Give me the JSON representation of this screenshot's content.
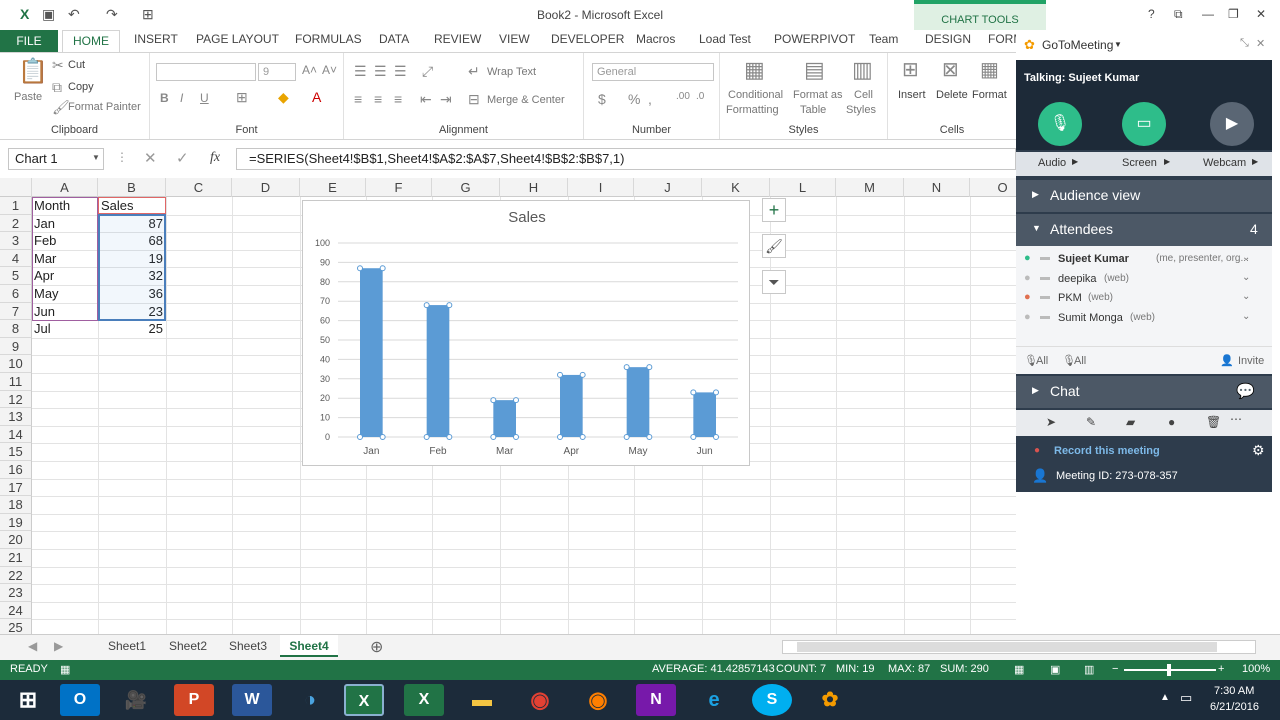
{
  "window": {
    "title": "Book2 - Microsoft Excel",
    "chart_tools": "CHART TOOLS"
  },
  "tabs": [
    "FILE",
    "HOME",
    "INSERT",
    "PAGE LAYOUT",
    "FORMULAS",
    "DATA",
    "REVIEW",
    "VIEW",
    "DEVELOPER",
    "Macros",
    "Load Test",
    "POWERPIVOT",
    "Team",
    "DESIGN",
    "FORMAT"
  ],
  "ribbon": {
    "paste": "Paste",
    "cut": "Cut",
    "copy": "Copy",
    "format_painter": "Format Painter",
    "clipboard": "Clipboard",
    "font_size": "9",
    "font_group": "Font",
    "wrap_text": "Wrap Text",
    "merge_center": "Merge & Center",
    "alignment": "Alignment",
    "number_format": "General",
    "number": "Number",
    "conditional": "Conditional",
    "formatting": "Formatting",
    "format_as": "Format as",
    "table": "Table",
    "cell": "Cell",
    "styles_btn": "Styles",
    "styles": "Styles",
    "insert": "Insert",
    "delete": "Delete",
    "format": "Format",
    "cells": "Cells"
  },
  "formula_bar": {
    "name_box": "Chart 1",
    "fx": "fx",
    "formula": "=SERIES(Sheet4!$B$1,Sheet4!$A$2:$A$7,Sheet4!$B$2:$B$7,1)"
  },
  "columns": [
    "A",
    "B",
    "C",
    "D",
    "E",
    "F",
    "G",
    "H",
    "I",
    "J",
    "K",
    "L",
    "M",
    "N",
    "O"
  ],
  "rows": [
    "1",
    "2",
    "3",
    "4",
    "5",
    "6",
    "7",
    "8",
    "9",
    "10",
    "11",
    "12",
    "13",
    "14",
    "15",
    "16",
    "17",
    "18",
    "19",
    "20",
    "21",
    "22",
    "23",
    "24",
    "25"
  ],
  "cells": {
    "a": [
      "Month",
      "Jan",
      "Feb",
      "Mar",
      "Apr",
      "May",
      "Jun",
      "Jul"
    ],
    "b": [
      "Sales",
      "87",
      "68",
      "19",
      "32",
      "36",
      "23",
      "25"
    ]
  },
  "chart_data": {
    "type": "bar",
    "title": "Sales",
    "categories": [
      "Jan",
      "Feb",
      "Mar",
      "Apr",
      "May",
      "Jun"
    ],
    "values": [
      87,
      68,
      19,
      32,
      36,
      23
    ],
    "ylim": [
      0,
      100
    ],
    "yticks": [
      "0",
      "10",
      "20",
      "30",
      "40",
      "50",
      "60",
      "70",
      "80",
      "90",
      "100"
    ],
    "color": "#5b9bd5",
    "grid": true
  },
  "sheets": [
    "Sheet1",
    "Sheet2",
    "Sheet3",
    "Sheet4"
  ],
  "active_sheet": "Sheet4",
  "status": {
    "ready": "READY",
    "average": "AVERAGE: 41.42857143",
    "count": "COUNT: 7",
    "min": "MIN: 19",
    "max": "MAX: 87",
    "sum": "SUM: 290",
    "zoom": "100%"
  },
  "gtm": {
    "app": "GoToMeeting",
    "talking": "Talking: Sujeet Kumar",
    "audio": "Audio",
    "screen": "Screen",
    "webcam": "Webcam",
    "audience_view": "Audience view",
    "attendees": "Attendees",
    "attendee_count": "4",
    "people": [
      {
        "name": "Sujeet Kumar",
        "meta": "(me, presenter, org..."
      },
      {
        "name": "deepika",
        "meta": "(web)"
      },
      {
        "name": "PKM",
        "meta": "(web)"
      },
      {
        "name": "Sumit Monga",
        "meta": "(web)"
      }
    ],
    "all1": "All",
    "all2": "All",
    "invite": "Invite",
    "chat": "Chat",
    "record": "Record this meeting",
    "meeting_id": "Meeting ID: 273-078-357"
  },
  "taskbar": {
    "time": "7:30 AM",
    "date": "6/21/2016"
  }
}
